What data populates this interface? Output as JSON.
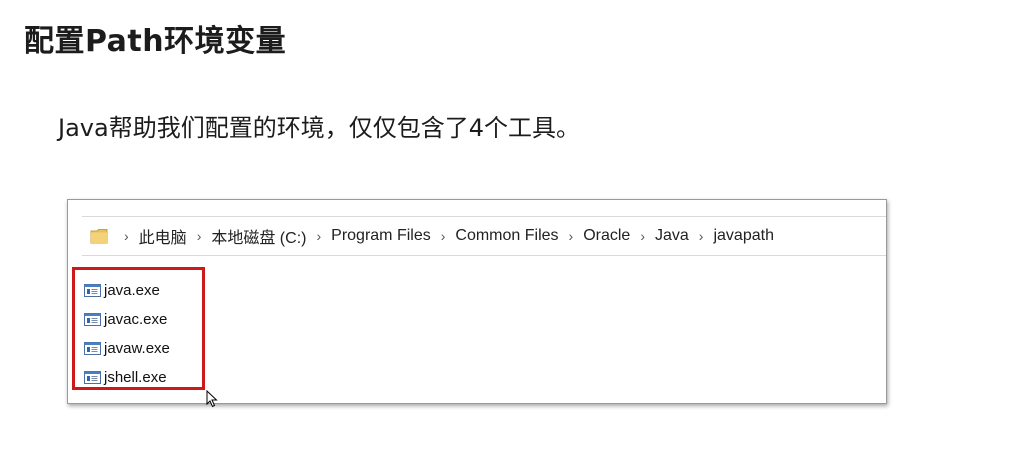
{
  "slide": {
    "title": "配置Path环境变量",
    "body": "Java帮助我们配置的环境，仅仅包含了4个工具。"
  },
  "explorer": {
    "breadcrumb": [
      "此电脑",
      "本地磁盘 (C:)",
      "Program Files",
      "Common Files",
      "Oracle",
      "Java",
      "javapath"
    ],
    "files": [
      {
        "name": "java.exe"
      },
      {
        "name": "javac.exe"
      },
      {
        "name": "javaw.exe"
      },
      {
        "name": "jshell.exe"
      }
    ]
  },
  "colors": {
    "highlight": "#cc1a1a",
    "folder": "#e8c15a"
  },
  "icons": {
    "folder": "folder-icon",
    "separator": "chevron-right-icon",
    "file": "exe-file-icon",
    "cursor": "mouse-cursor-icon"
  }
}
